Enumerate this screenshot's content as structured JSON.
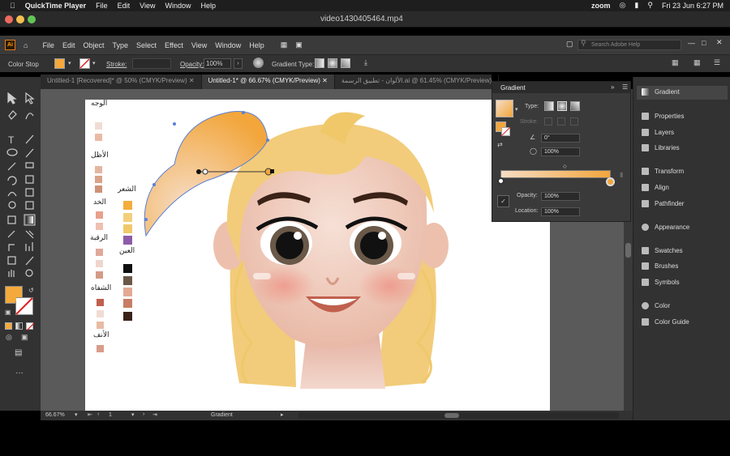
{
  "mac_menubar": {
    "app_name": "QuickTime Player",
    "menus": [
      "File",
      "Edit",
      "View",
      "Window",
      "Help"
    ],
    "status": {
      "zoom": "zoom",
      "datetime": "Fri 23 Jun  6:27 PM"
    }
  },
  "quicktime": {
    "file_title": "video1430405464.mp4"
  },
  "illustrator": {
    "logo": "Ai",
    "menus": [
      "File",
      "Edit",
      "Object",
      "Type",
      "Select",
      "Effect",
      "View",
      "Window",
      "Help"
    ],
    "search_placeholder": "Search Adobe Help"
  },
  "control_bar": {
    "mode_label": "Color Stop",
    "stroke_label": "Stroke:",
    "opacity_label": "Opacity:",
    "opacity_value": "100%",
    "gradient_type_label": "Gradient Type:"
  },
  "tabs": [
    {
      "label": "Untitled-1 [Recovered]* @ 50% (CMYK/Preview)",
      "active": false
    },
    {
      "label": "Untitled-1* @ 66.67% (CMYK/Preview)",
      "active": true
    },
    {
      "label": "الألوان - تطبيق الرسمة.ai @ 61.45% (CMYK/Preview)",
      "active": false
    }
  ],
  "gradient_panel": {
    "title": "Gradient",
    "type_label": "Type:",
    "stroke_label": "Stroke:",
    "angle_value": "0°",
    "aspect_value": "100%",
    "opacity_label": "Opacity:",
    "opacity_value": "100%",
    "location_label": "Location:",
    "location_value": "100%",
    "colors": {
      "start": "#f6dcc4",
      "end": "#f2a63c"
    }
  },
  "right_panel": {
    "active": "Gradient",
    "group1": [
      "Properties",
      "Layers",
      "Libraries"
    ],
    "group2": [
      "Transform",
      "Align",
      "Pathfinder"
    ],
    "group3": [
      "Appearance"
    ],
    "group4": [
      "Swatches",
      "Brushes",
      "Symbols"
    ],
    "group5": [
      "Color",
      "Color Guide"
    ]
  },
  "status_bar": {
    "zoom": "66.67%",
    "artboard": "1",
    "tool": "Gradient"
  },
  "artboard_labels": {
    "face": "الوجه",
    "shadow": "الأظل",
    "cheek": "الخد",
    "neck": "الرقبة",
    "lips": "الشفاه",
    "nose": "الأنف",
    "hair": "الشعر",
    "eyes": "العين"
  },
  "palette": {
    "face": [
      "#f1dcd4",
      "#e9bba5"
    ],
    "shadow": [
      "#e3b6a3",
      "#d9a28a",
      "#cf9279"
    ],
    "cheek": [
      "#e8a08c",
      "#efc0b0"
    ],
    "neck": [
      "#e0a89a",
      "#efd6cc",
      "#d49a86"
    ],
    "lips": [
      "#c0604e",
      "#f0dcd4",
      "#e9bba5"
    ],
    "nose": [
      "#d99c8a"
    ],
    "hair": [
      "#f2ad3d",
      "#f3cf7d",
      "#f0c86a",
      "#8e5ba8"
    ],
    "eyes": [
      "#0f0f0f",
      "#6a5848",
      "#e3aa93",
      "#c97d64",
      "#3a2217"
    ]
  },
  "accent_fill": "#f4a93c"
}
